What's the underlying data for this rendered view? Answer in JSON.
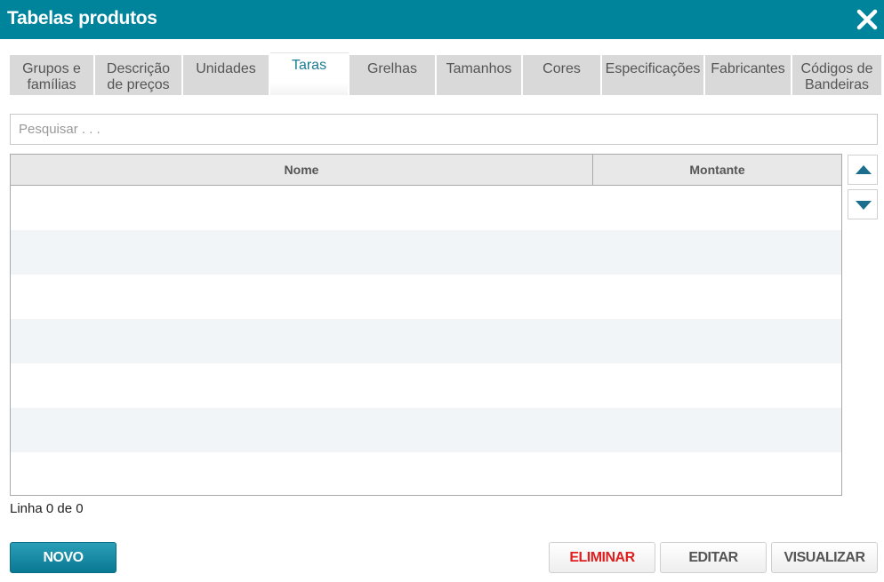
{
  "window": {
    "title": "Tabelas produtos",
    "close_icon": "close-icon"
  },
  "tabs": [
    {
      "label_line1": "Grupos e",
      "label_line2": "famílias"
    },
    {
      "label_line1": "Descrição",
      "label_line2": "de preços"
    },
    {
      "label_line1": "Unidades",
      "label_line2": ""
    },
    {
      "label_line1": "Taras",
      "label_line2": "",
      "active": true
    },
    {
      "label_line1": "Grelhas",
      "label_line2": ""
    },
    {
      "label_line1": "Tamanhos",
      "label_line2": ""
    },
    {
      "label_line1": "Cores",
      "label_line2": ""
    },
    {
      "label_line1": "Especificações",
      "label_line2": ""
    },
    {
      "label_line1": "Fabricantes",
      "label_line2": ""
    },
    {
      "label_line1": "Códigos de",
      "label_line2": "Bandeiras"
    }
  ],
  "search": {
    "placeholder": "Pesquisar . . .",
    "value": ""
  },
  "grid": {
    "columns": [
      "Nome",
      "Montante"
    ],
    "rows": []
  },
  "status": {
    "text": "Linha 0 de 0"
  },
  "buttons": {
    "new": "NOVO",
    "delete": "ELIMINAR",
    "edit": "EDITAR",
    "view": "VISUALIZAR"
  },
  "colors": {
    "titlebar": "#00849c",
    "active_tab_text": "#1a7a93",
    "delete_text": "#e02020",
    "primary_button": "#0a7892"
  }
}
